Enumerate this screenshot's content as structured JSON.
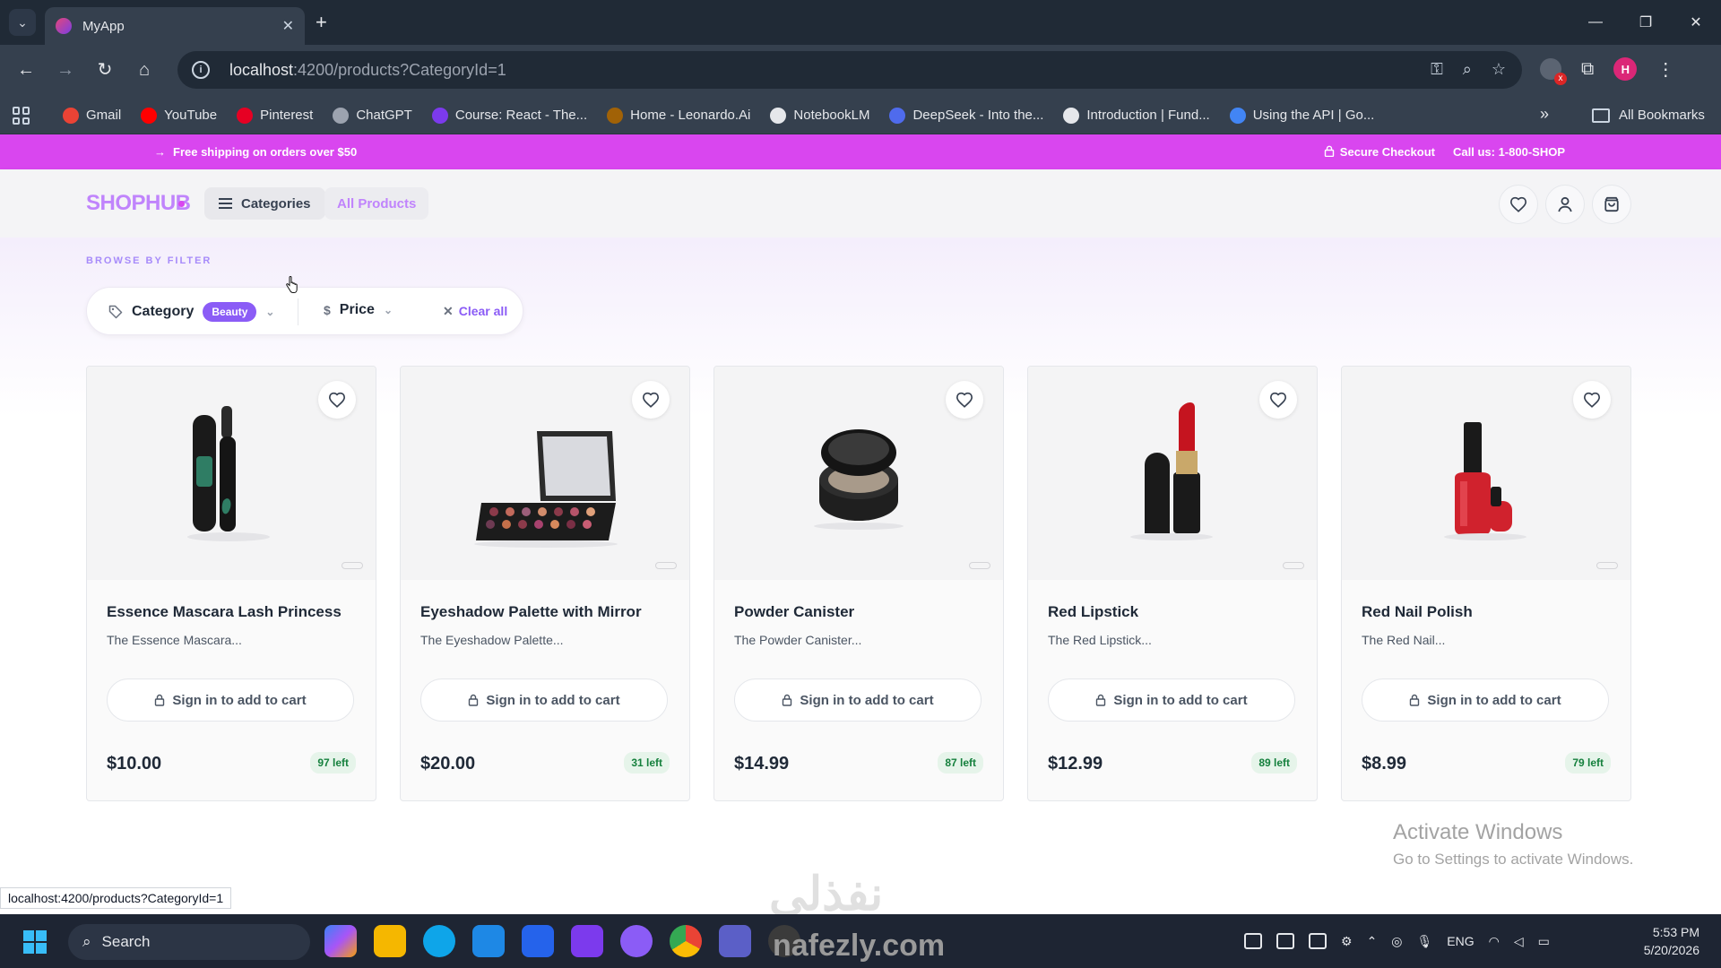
{
  "browser": {
    "tab_title": "MyApp",
    "url_host": "localhost",
    "url_rest": ":4200/products?CategoryId=1",
    "bookmarks": [
      "Gmail",
      "YouTube",
      "Pinterest",
      "ChatGPT",
      "Course: React - The...",
      "Home - Leonardo.Ai",
      "NotebookLM",
      "DeepSeek - Into the...",
      "Introduction | Fund...",
      "Using the API  |  Go..."
    ],
    "bookmark_colors": [
      "#ea4335",
      "#ff0000",
      "#e60023",
      "#9ca3af",
      "#7c3aed",
      "#a16207",
      "#e5e7eb",
      "#4f6bed",
      "#e5e7eb",
      "#4285f4"
    ],
    "all_bookmarks": "All Bookmarks",
    "status_url": "localhost:4200/products?CategoryId=1"
  },
  "promo": {
    "left": "Free shipping on orders over $50",
    "secure": "Secure Checkout",
    "call": "Call us: 1-800-SHOP"
  },
  "header": {
    "logo": "SHOPHUB",
    "categories_label": "Categories",
    "all_products_label": "All Products"
  },
  "filters": {
    "browse_label": "BROWSE BY FILTER",
    "category_label": "Category",
    "category_value": "Beauty",
    "price_label": "Price",
    "clear_label": "Clear all"
  },
  "products": [
    {
      "name": "Essence Mascara Lash Princess",
      "desc": "The Essence Mascara...",
      "cta": "Sign in to add to cart",
      "price": "$10.00",
      "stock": "97 left"
    },
    {
      "name": "Eyeshadow Palette with Mirror",
      "desc": "The Eyeshadow Palette...",
      "cta": "Sign in to add to cart",
      "price": "$20.00",
      "stock": "31 left"
    },
    {
      "name": "Powder Canister",
      "desc": "The Powder Canister...",
      "cta": "Sign in to add to cart",
      "price": "$14.99",
      "stock": "87 left"
    },
    {
      "name": "Red Lipstick",
      "desc": "The Red Lipstick...",
      "cta": "Sign in to add to cart",
      "price": "$12.99",
      "stock": "89 left"
    },
    {
      "name": "Red Nail Polish",
      "desc": "The Red Nail...",
      "cta": "Sign in to add to cart",
      "price": "$8.99",
      "stock": "79 left"
    }
  ],
  "windows": {
    "activate_title": "Activate Windows",
    "activate_sub": "Go to Settings to activate Windows.",
    "search": "Search",
    "lang": "ENG",
    "time": "5:53 PM",
    "date": "5/20/2026"
  },
  "watermark": {
    "arabic": "نفذلي",
    "latin": "nafezly.com"
  },
  "colors": {
    "accent": "#d946ef",
    "brand": "#c084fc",
    "badge": "#8b5cf6",
    "stock_bg": "#e6f4ea",
    "stock_text": "#15803d"
  }
}
